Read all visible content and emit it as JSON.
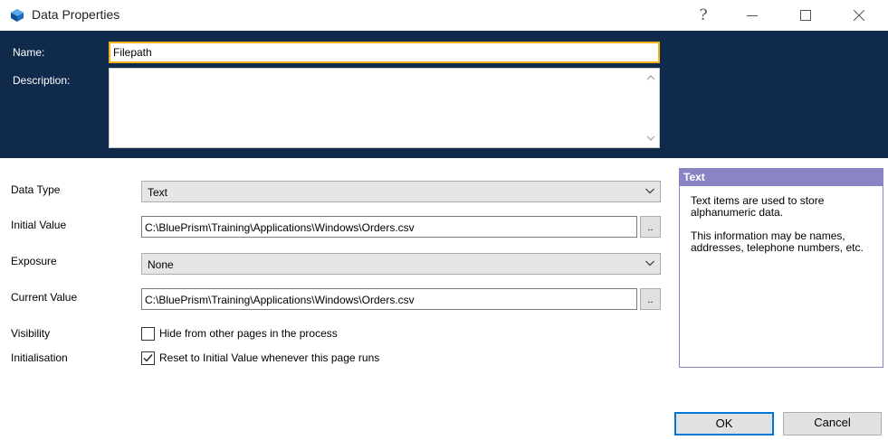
{
  "window": {
    "title": "Data Properties",
    "help_glyph": "?",
    "min_glyph": "—",
    "max_glyph": "☐",
    "close_glyph": "✕",
    "icon": "blue-prism-app-icon"
  },
  "header": {
    "name_label": "Name:",
    "name_value": "Filepath",
    "description_label": "Description:",
    "description_value": ""
  },
  "form": {
    "data_type_label": "Data Type",
    "data_type_value": "Text",
    "initial_value_label": "Initial Value",
    "initial_value": "C:\\BluePrism\\Training\\Applications\\Windows\\Orders.csv",
    "exposure_label": "Exposure",
    "exposure_value": "None",
    "current_value_label": "Current Value",
    "current_value": "C:\\BluePrism\\Training\\Applications\\Windows\\Orders.csv",
    "visibility_label": "Visibility",
    "visibility_checkbox_label": "Hide from other pages in the process",
    "visibility_checked": false,
    "initialisation_label": "Initialisation",
    "initialisation_checkbox_label": "Reset to Initial Value whenever this page runs",
    "initialisation_checked": true,
    "browse_label": ".."
  },
  "info_panel": {
    "title": "Text",
    "paragraph1": "Text items are used to store alphanumeric data.",
    "paragraph2": "This information may be names, addresses, telephone numbers, etc."
  },
  "buttons": {
    "ok_label": "OK",
    "cancel_label": "Cancel"
  },
  "colors": {
    "header_bg": "#102a4b",
    "focus_border": "#f2b318",
    "info_accent": "#8a84c4",
    "default_button_border": "#0078d7"
  }
}
